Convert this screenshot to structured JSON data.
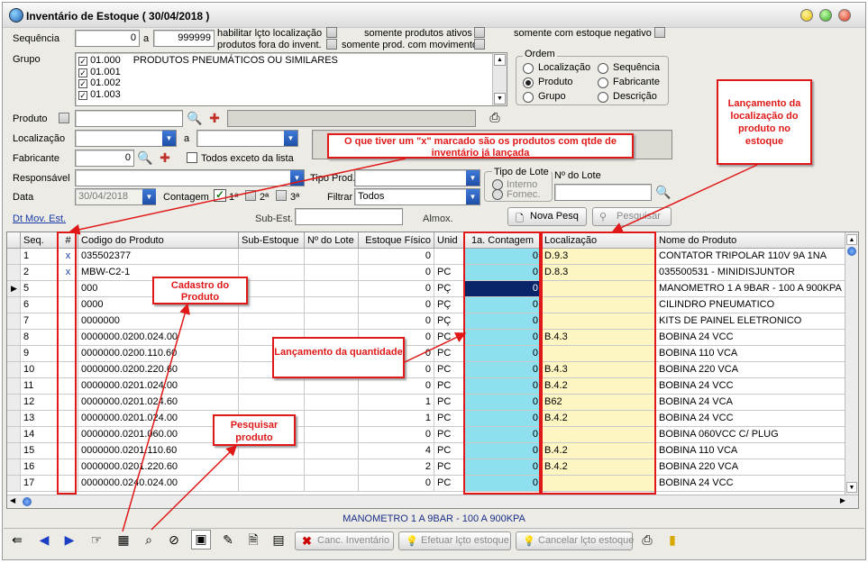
{
  "window": {
    "title": "Inventário de Estoque ( 30/04/2018 )"
  },
  "filters": {
    "sequencia_label": "Sequência",
    "seq_from": "0",
    "a_label": "a",
    "seq_to": "999999",
    "habilitar_label": "habilitar lçto localização",
    "fora_label": "produtos fora do invent.",
    "ativos_label": "somente produtos ativos",
    "movimento_label": "somente prod. com movimento",
    "negativo_label": "somente com estoque negativo",
    "grupo_label": "Grupo",
    "grupos": [
      {
        "code": "01.000",
        "name": "PRODUTOS PNEUMÁTICOS OU SIMILARES"
      },
      {
        "code": "01.001",
        "name": ""
      },
      {
        "code": "01.002",
        "name": ""
      },
      {
        "code": "01.003",
        "name": ""
      }
    ],
    "produto_label": "Produto",
    "localizacao_label": "Localização",
    "a2_label": "a",
    "fabricante_label": "Fabricante",
    "fabricante_value": "0",
    "todos_exceto_label": "Todos exceto da lista",
    "responsavel_label": "Responsável",
    "tipo_prod_label": "Tipo Prod.",
    "data_label": "Data",
    "data_value": "30/04/2018",
    "contagem_label": "Contagem",
    "contagem_opts": [
      "1ª",
      "2ª",
      "3ª"
    ],
    "filtrar_label": "Filtrar",
    "filtrar_value": "Todos",
    "dt_mov_label": "Dt Mov. Est.",
    "sub_est_label": "Sub-Est.",
    "almox_label": "Almox.",
    "tipo_lote_label": "Tipo de Lote",
    "interno_label": "Interno",
    "fornec_label": "Fornec.",
    "nlote_label": "Nº do Lote"
  },
  "ordem": {
    "title": "Ordem",
    "options": [
      "Localização",
      "Sequência",
      "Produto",
      "Fabricante",
      "Grupo",
      "Descrição"
    ],
    "selected": "Produto"
  },
  "buttons": {
    "nova_pesq": "Nova Pesq",
    "pesquisar": "Pesquisar",
    "canc_inventario": "Canc. Inventário",
    "efetuar": "Efetuar lçto estoque",
    "cancelar": "Cancelar lçto estoque"
  },
  "table": {
    "headers": [
      "Seq.",
      "#",
      "Codigo do Produto",
      "Sub-Estoque",
      "Nº do Lote",
      "Estoque Físico",
      "Unid",
      "1a. Contagem",
      "Localização",
      "Nome do Produto"
    ],
    "rows": [
      {
        "seq": "1",
        "mark": "x",
        "code": "035502377",
        "estoque": "0",
        "unid": "",
        "contagem": "0",
        "loc": "D.9.3",
        "nome": "CONTATOR TRIPOLAR 110V 9A 1NA"
      },
      {
        "seq": "2",
        "mark": "x",
        "code": "MBW-C2-1",
        "estoque": "0",
        "unid": "PC",
        "contagem": "0",
        "loc": "D.8.3",
        "nome": "035500531 - MINIDISJUNTOR"
      },
      {
        "seq": "5",
        "mark": "",
        "code": "000",
        "estoque": "0",
        "unid": "PÇ",
        "contagem": "0",
        "loc": "",
        "nome": "MANOMETRO 1 A 9BAR - 100 A 900KPA"
      },
      {
        "seq": "6",
        "mark": "",
        "code": "0000",
        "estoque": "0",
        "unid": "PÇ",
        "contagem": "0",
        "loc": "",
        "nome": "CILINDRO PNEUMATICO"
      },
      {
        "seq": "7",
        "mark": "",
        "code": "0000000",
        "estoque": "0",
        "unid": "PÇ",
        "contagem": "0",
        "loc": "",
        "nome": "KITS DE PAINEL ELETRONICO"
      },
      {
        "seq": "8",
        "mark": "",
        "code": "0000000.0200.024.00",
        "estoque": "0",
        "unid": "PC",
        "contagem": "0",
        "loc": "B.4.3",
        "nome": "BOBINA 24 VCC"
      },
      {
        "seq": "9",
        "mark": "",
        "code": "0000000.0200.110.60",
        "estoque": "0",
        "unid": "PC",
        "contagem": "0",
        "loc": "",
        "nome": "BOBINA 110 VCA"
      },
      {
        "seq": "10",
        "mark": "",
        "code": "0000000.0200.220.60",
        "estoque": "0",
        "unid": "PC",
        "contagem": "0",
        "loc": "B.4.3",
        "nome": "BOBINA 220 VCA"
      },
      {
        "seq": "11",
        "mark": "",
        "code": "0000000.0201.024.00",
        "estoque": "0",
        "unid": "PC",
        "contagem": "0",
        "loc": "B.4.2",
        "nome": "BOBINA 24 VCC"
      },
      {
        "seq": "12",
        "mark": "",
        "code": "0000000.0201.024.60",
        "estoque": "1",
        "unid": "PC",
        "contagem": "0",
        "loc": "B62",
        "nome": "BOBINA 24 VCA"
      },
      {
        "seq": "13",
        "mark": "",
        "code": "0000000.0201.024.00",
        "estoque": "1",
        "unid": "PC",
        "contagem": "0",
        "loc": "B.4.2",
        "nome": "BOBINA 24 VCC"
      },
      {
        "seq": "14",
        "mark": "",
        "code": "0000000.0201.060.00",
        "estoque": "0",
        "unid": "PC",
        "contagem": "0",
        "loc": "",
        "nome": "BOBINA 060VCC C/ PLUG"
      },
      {
        "seq": "15",
        "mark": "",
        "code": "0000000.0201.110.60",
        "estoque": "4",
        "unid": "PC",
        "contagem": "0",
        "loc": "B.4.2",
        "nome": "BOBINA 110 VCA"
      },
      {
        "seq": "16",
        "mark": "",
        "code": "0000000.0201.220.60",
        "estoque": "2",
        "unid": "PC",
        "contagem": "0",
        "loc": "B.4.2",
        "nome": "BOBINA 220 VCA"
      },
      {
        "seq": "17",
        "mark": "",
        "code": "0000000.0240.024.00",
        "estoque": "0",
        "unid": "PC",
        "contagem": "0",
        "loc": "",
        "nome": "BOBINA 24 VCC"
      }
    ]
  },
  "status": {
    "product": "MANOMETRO 1 A 9BAR - 100 A 900KPA"
  },
  "notes": {
    "marcado": "O que tiver um \"x\" marcado são os produtos com qtde de inventário já lançada",
    "localizacao": "Lançamento da localização do produto no estoque",
    "cadastro": "Cadastro do Produto",
    "quantidade": "Lançamento da quantidade",
    "pesquisar": "Pesquisar produto"
  },
  "colors": {
    "annotation": "#e01818",
    "count_col": "#8fe0ee",
    "loc_col": "#fdf6c2",
    "selection": "#0a246a"
  }
}
